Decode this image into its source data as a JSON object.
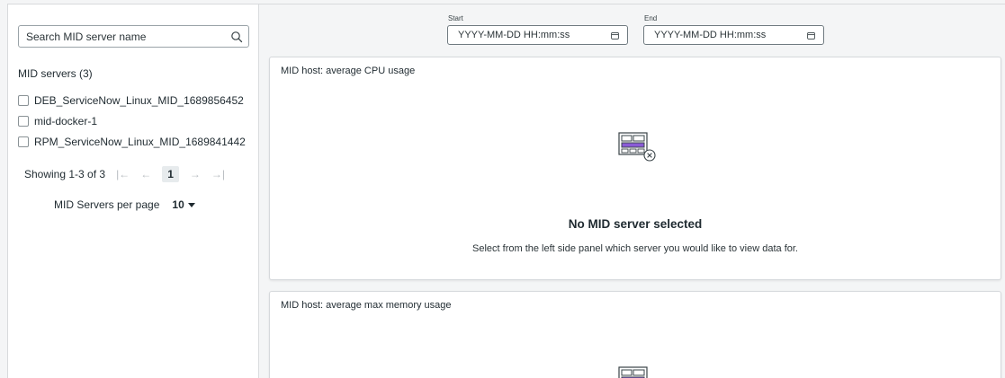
{
  "sidebar": {
    "search_placeholder": "Search MID server name",
    "list_title": "MID servers (3)",
    "servers": [
      {
        "label": "DEB_ServiceNow_Linux_MID_1689856452",
        "checked": false
      },
      {
        "label": "mid-docker-1",
        "checked": false
      },
      {
        "label": "RPM_ServiceNow_Linux_MID_1689841442",
        "checked": false
      }
    ],
    "pagination": {
      "showing": "Showing 1-3 of 3",
      "first": "|←",
      "prev": "←",
      "current": "1",
      "next": "→",
      "last": "→|"
    },
    "per_page_label": "MID Servers per page",
    "per_page_value": "10"
  },
  "date_range": {
    "start_label": "Start",
    "start_placeholder": "YYYY-MM-DD HH:mm:ss",
    "end_label": "End",
    "end_placeholder": "YYYY-MM-DD HH:mm:ss"
  },
  "cards": [
    {
      "title": "MID host: average CPU usage",
      "empty_title": "No MID server selected",
      "empty_desc": "Select from the left side panel which server you would like to view data for."
    },
    {
      "title": "MID host: average max memory usage"
    }
  ],
  "colors": {
    "accent_purple": "#8a5bd6",
    "icon_stroke": "#3a4448"
  }
}
